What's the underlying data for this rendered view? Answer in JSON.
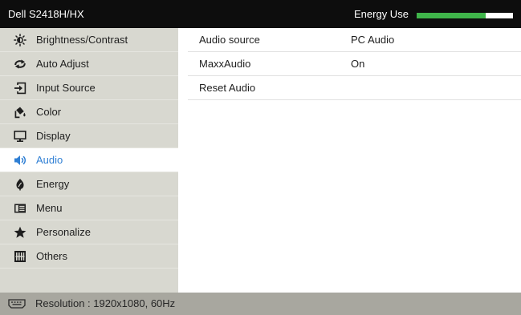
{
  "header": {
    "model": "Dell S2418H/HX",
    "energy_label": "Energy Use",
    "energy_level": 0.72
  },
  "sidebar": {
    "items": [
      {
        "label": "Brightness/Contrast",
        "icon": "brightness-icon",
        "selected": false
      },
      {
        "label": "Auto Adjust",
        "icon": "auto-adjust-icon",
        "selected": false
      },
      {
        "label": "Input Source",
        "icon": "input-source-icon",
        "selected": false
      },
      {
        "label": "Color",
        "icon": "color-icon",
        "selected": false
      },
      {
        "label": "Display",
        "icon": "display-icon",
        "selected": false
      },
      {
        "label": "Audio",
        "icon": "speaker-icon",
        "selected": true
      },
      {
        "label": "Energy",
        "icon": "energy-leaf-icon",
        "selected": false
      },
      {
        "label": "Menu",
        "icon": "menu-icon",
        "selected": false
      },
      {
        "label": "Personalize",
        "icon": "star-icon",
        "selected": false
      },
      {
        "label": "Others",
        "icon": "others-icon",
        "selected": false
      }
    ]
  },
  "main": {
    "rows": [
      {
        "label": "Audio source",
        "value": "PC Audio"
      },
      {
        "label": "MaxxAudio",
        "value": "On"
      },
      {
        "label": "Reset Audio"
      }
    ]
  },
  "footer": {
    "icon": "connector-icon",
    "resolution": "Resolution : 1920x1080, 60Hz"
  },
  "colors": {
    "header_bg": "#0d0d0d",
    "header_text": "#ffffff",
    "sidebar_bg": "#d8d8d0",
    "footer_bg": "#a8a79f",
    "selected_text": "#2f7fd4",
    "energy_fill": "#3fb54a",
    "energy_track": "#ffffff",
    "text": "#1e1e1e"
  }
}
